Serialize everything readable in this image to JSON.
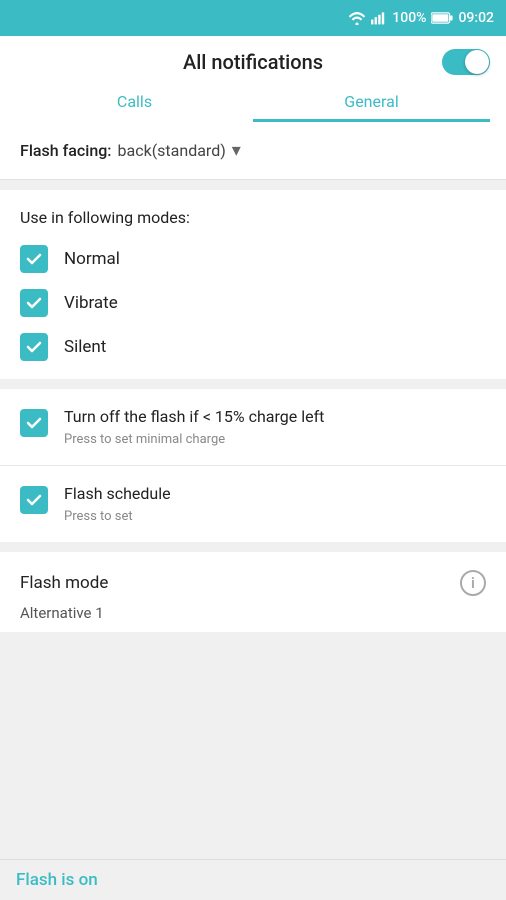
{
  "statusBar": {
    "wifi": "wifi",
    "signal": "signal",
    "battery": "100%",
    "time": "09:02"
  },
  "header": {
    "title": "All notifications",
    "toggleOn": true
  },
  "tabs": [
    {
      "label": "Calls",
      "active": false
    },
    {
      "label": "General",
      "active": true
    }
  ],
  "flashFacing": {
    "label": "Flash facing:",
    "value": "back(standard)"
  },
  "modesSection": {
    "title": "Use in following modes:",
    "modes": [
      {
        "label": "Normal",
        "checked": true
      },
      {
        "label": "Vibrate",
        "checked": true
      },
      {
        "label": "Silent",
        "checked": true
      }
    ]
  },
  "items": [
    {
      "title": "Turn off the flash if < 15% charge left",
      "subtitle": "Press to set minimal charge",
      "checked": true
    },
    {
      "title": "Flash schedule",
      "subtitle": "Press to set",
      "checked": true
    }
  ],
  "flashMode": {
    "title": "Flash mode",
    "value": "Alternative 1"
  },
  "bottomStatus": {
    "label": "Flash is on"
  }
}
